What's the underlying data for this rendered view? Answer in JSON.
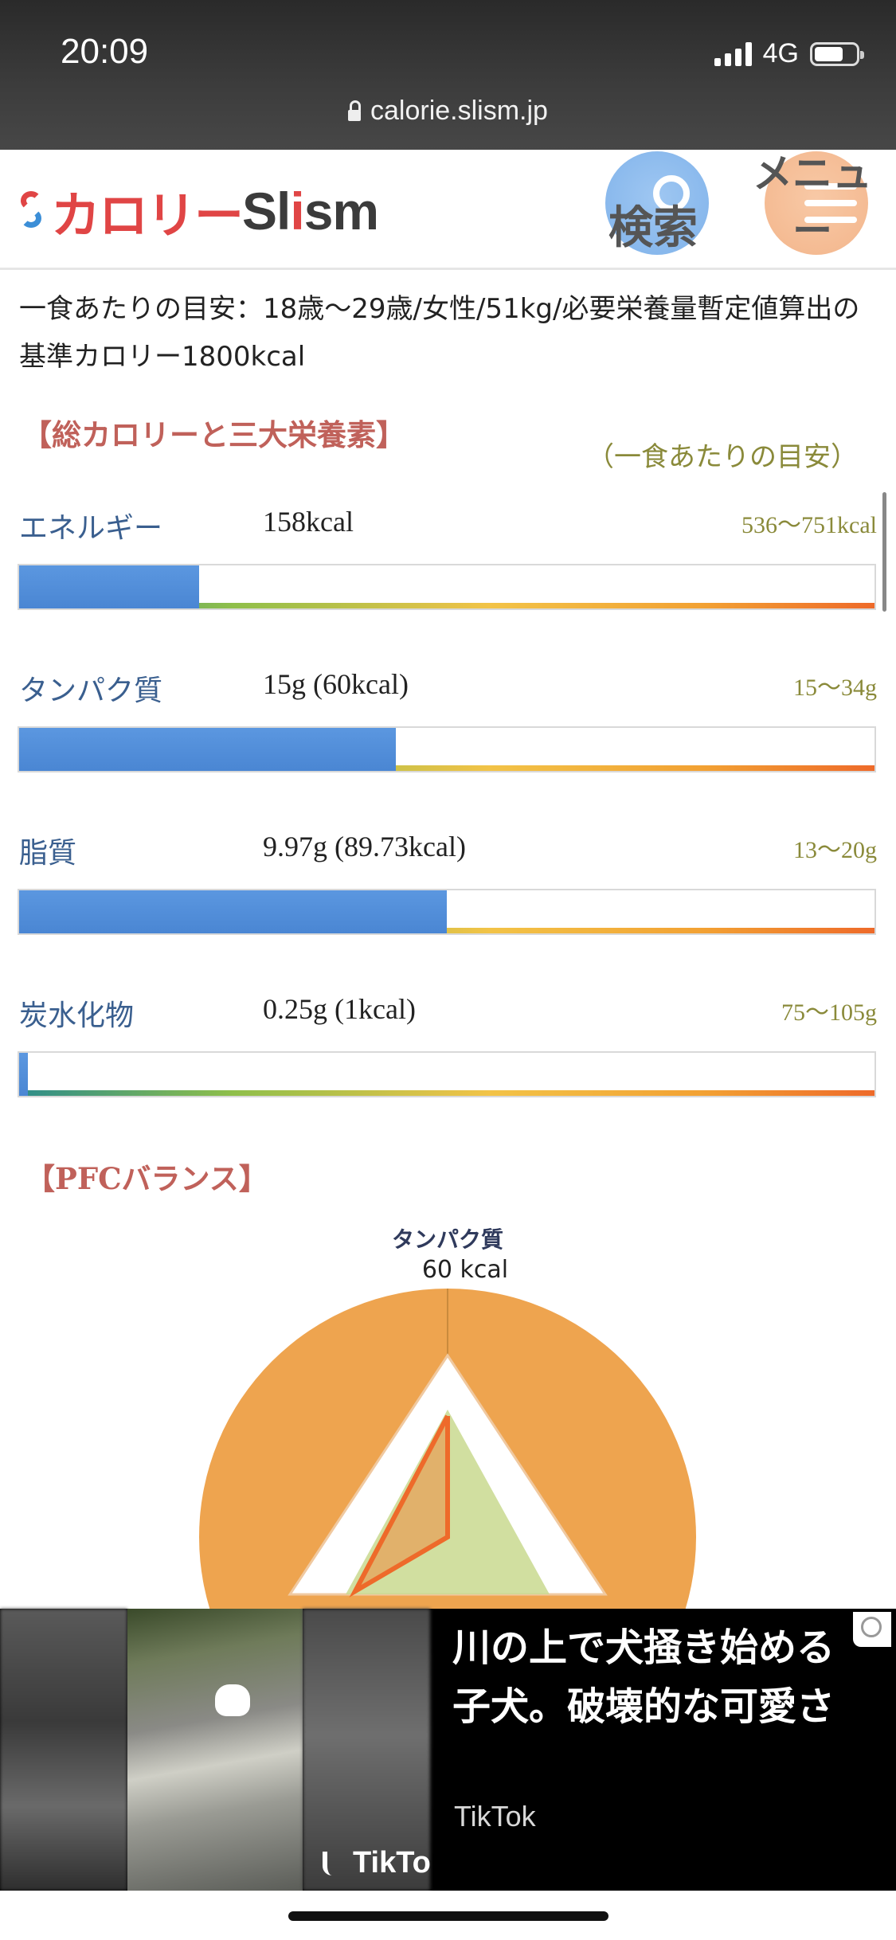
{
  "status_bar": {
    "time": "20:09",
    "network": "4G"
  },
  "browser": {
    "url": "calorie.slism.jp"
  },
  "header": {
    "logo_ja": "カロリー",
    "logo_en_1": "Sl",
    "logo_en_2": "i",
    "logo_en_3": "sm",
    "search_label": "検索",
    "menu_label": "メニュー"
  },
  "intro": "一食あたりの目安：18歳〜29歳/女性/51kg/必要栄養量暫定値算出の基準カロリー1800kcal",
  "nutrition_section": {
    "title": "【総カロリーと三大栄養素】",
    "note": "（一食あたりの目安）",
    "items": [
      {
        "name": "エネルギー",
        "value": "158kcal",
        "range": "536〜751kcal",
        "fill_fraction": 0.21
      },
      {
        "name": "タンパク質",
        "value": "15g (60kcal)",
        "range": "15〜34g",
        "fill_fraction": 0.44
      },
      {
        "name": "脂質",
        "value": "9.97g (89.73kcal)",
        "range": "13〜20g",
        "fill_fraction": 0.5
      },
      {
        "name": "炭水化物",
        "value": "0.25g (1kcal)",
        "range": "75〜105g",
        "fill_fraction": 0.01
      }
    ]
  },
  "pfc_section": {
    "title": "【PFCバランス】",
    "protein_label": "タンパク質",
    "protein_value": "60 kcal"
  },
  "ad": {
    "headline": "川の上で犬掻き始める子犬。破壊的な可愛さ",
    "source": "TikTok",
    "brand": "TikTok"
  }
}
